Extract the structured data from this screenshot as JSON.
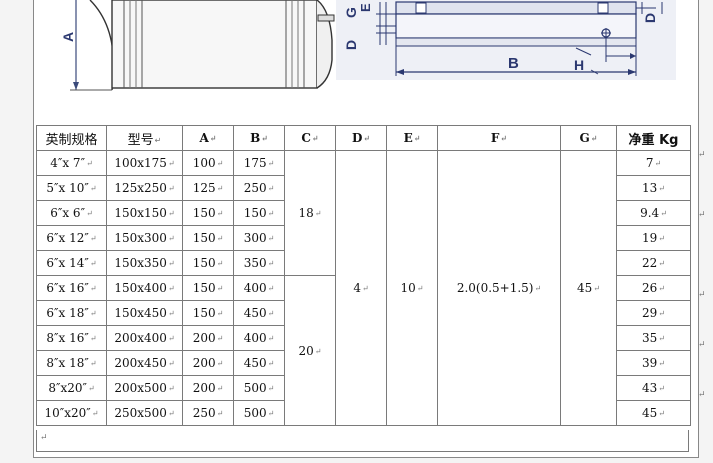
{
  "figure_labels": {
    "left_a": "A",
    "right_g": "G",
    "right_e": "E",
    "right_d_left": "D",
    "right_d_right": "D",
    "right_b": "B",
    "right_h": "H"
  },
  "table": {
    "headers": {
      "size": "英制规格",
      "model": "型号",
      "a": "A",
      "b": "B",
      "c": "C",
      "d": "D",
      "e": "E",
      "f": "F",
      "g": "G",
      "weight": "净重 Kg"
    },
    "rows": [
      {
        "size": "4″x 7″",
        "model": "100x175",
        "a": "100",
        "b": "175",
        "weight": "7"
      },
      {
        "size": "5″x 10″",
        "model": "125x250",
        "a": "125",
        "b": "250",
        "weight": "13"
      },
      {
        "size": "6″x 6″",
        "model": "150x150",
        "a": "150",
        "b": "150",
        "weight": "9.4"
      },
      {
        "size": "6″x 12″",
        "model": "150x300",
        "a": "150",
        "b": "300",
        "weight": "19"
      },
      {
        "size": "6″x 14″",
        "model": "150x350",
        "a": "150",
        "b": "350",
        "weight": "22"
      },
      {
        "size": "6″x 16″",
        "model": "150x400",
        "a": "150",
        "b": "400",
        "weight": "26"
      },
      {
        "size": "6″x 18″",
        "model": "150x450",
        "a": "150",
        "b": "450",
        "weight": "29"
      },
      {
        "size": "8″x 16″",
        "model": "200x400",
        "a": "200",
        "b": "400",
        "weight": "35"
      },
      {
        "size": "8″x 18″",
        "model": "200x450",
        "a": "200",
        "b": "450",
        "weight": "39"
      },
      {
        "size": "8″x20″",
        "model": "200x500",
        "a": "200",
        "b": "500",
        "weight": "43"
      },
      {
        "size": "10″x20″",
        "model": "250x500",
        "a": "250",
        "b": "500",
        "weight": "45"
      }
    ],
    "merged": {
      "c_upper": "18",
      "c_lower": "20",
      "d": "4",
      "e": "10",
      "f": "2.0(0.5+1.5)",
      "g": "45"
    }
  }
}
